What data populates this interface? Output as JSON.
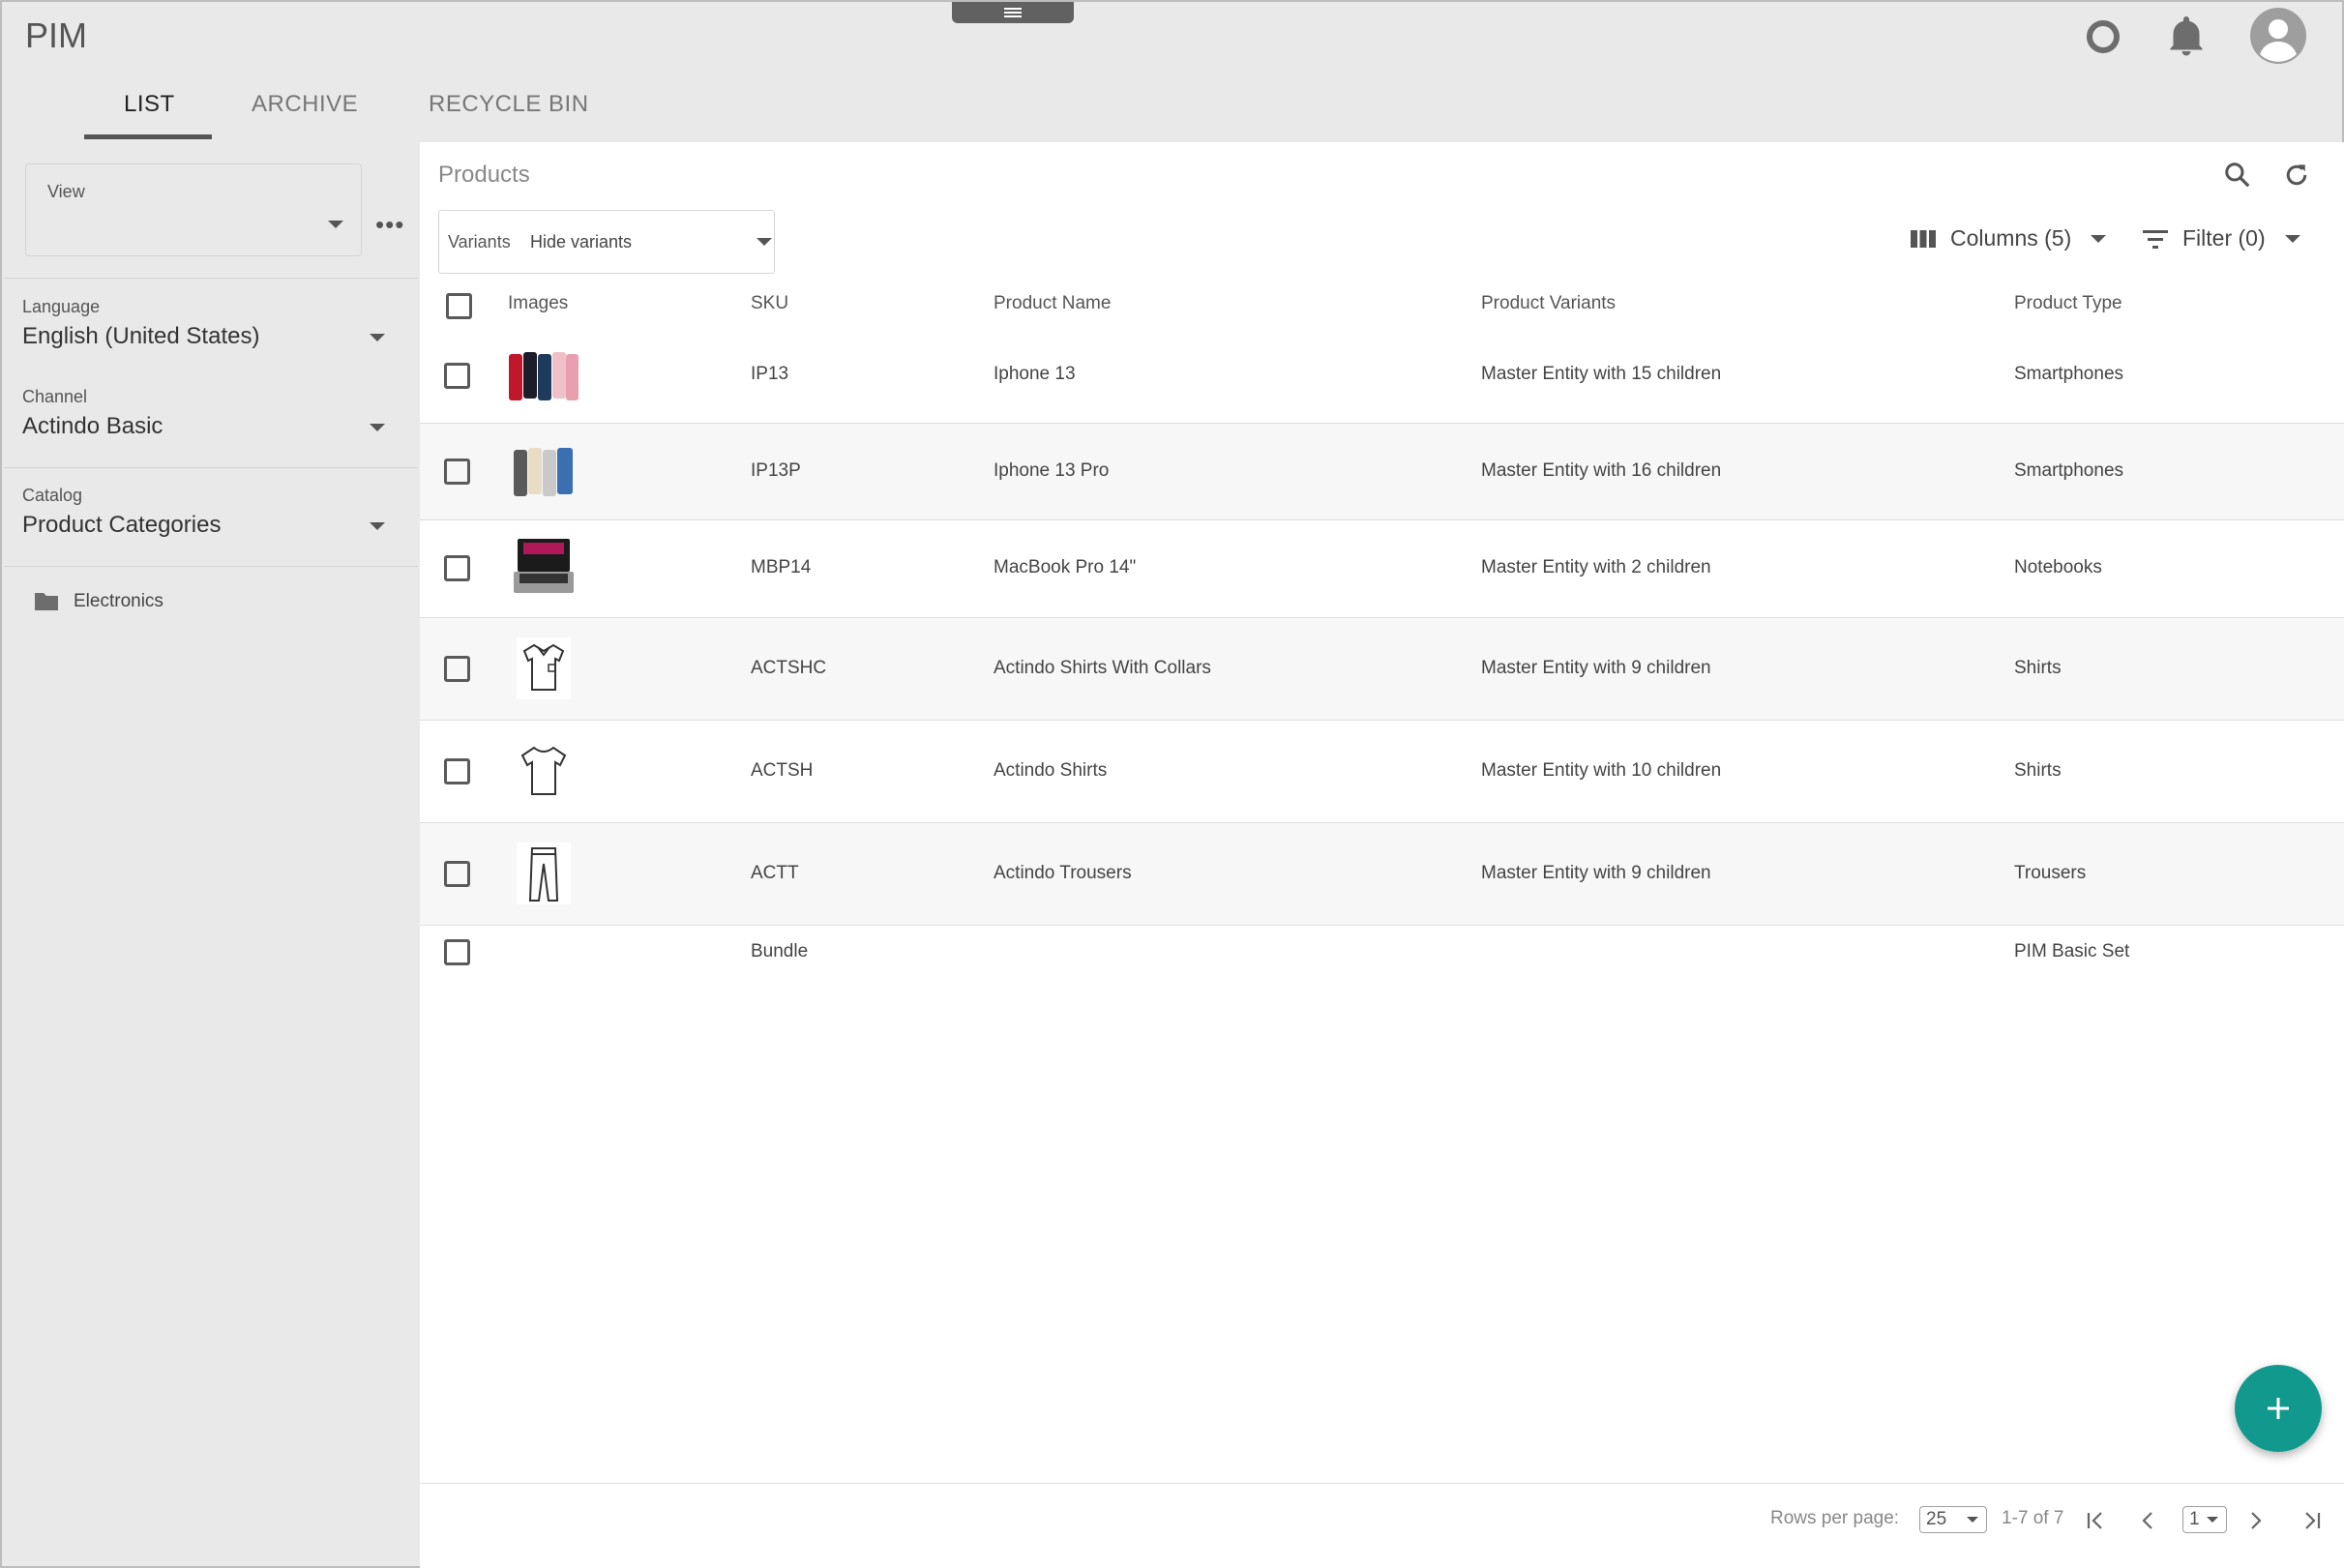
{
  "app": {
    "title": "PIM"
  },
  "tabs": [
    {
      "label": "LIST",
      "active": true
    },
    {
      "label": "ARCHIVE",
      "active": false
    },
    {
      "label": "RECYCLE BIN",
      "active": false
    }
  ],
  "sidebar": {
    "view_label": "View",
    "view_value": "",
    "language_label": "Language",
    "language_value": "English (United States)",
    "channel_label": "Channel",
    "channel_value": "Actindo Basic",
    "catalog_label": "Catalog",
    "catalog_value": "Product Categories",
    "tree": [
      {
        "label": "Electronics",
        "icon": "folder-icon"
      }
    ]
  },
  "main": {
    "title": "Products",
    "variants_label": "Variants",
    "variants_value": "Hide variants",
    "columns_label": "Columns (5)",
    "filter_label": "Filter (0)"
  },
  "table": {
    "headers": [
      "Images",
      "SKU",
      "Product Name",
      "Product Variants",
      "Product Type"
    ],
    "rows": [
      {
        "image": "iphone-13-image",
        "sku": "IP13",
        "name": "Iphone 13",
        "variants": "Master Entity with 15 children",
        "type": "Smartphones"
      },
      {
        "image": "iphone-13-pro-image",
        "sku": "IP13P",
        "name": "Iphone 13 Pro",
        "variants": "Master Entity with 16 children",
        "type": "Smartphones"
      },
      {
        "image": "macbook-image",
        "sku": "MBP14",
        "name": "MacBook Pro 14\"",
        "variants": "Master Entity with 2 children",
        "type": "Notebooks"
      },
      {
        "image": "collar-shirt-image",
        "sku": "ACTSHC",
        "name": "Actindo Shirts With Collars",
        "variants": "Master Entity with 9 children",
        "type": "Shirts"
      },
      {
        "image": "tshirt-image",
        "sku": "ACTSH",
        "name": "Actindo Shirts",
        "variants": "Master Entity with 10 children",
        "type": "Shirts"
      },
      {
        "image": "trousers-image",
        "sku": "ACTT",
        "name": "Actindo Trousers",
        "variants": "Master Entity with 9 children",
        "type": "Trousers"
      },
      {
        "image": "",
        "sku": "Bundle",
        "name": "",
        "variants": "",
        "type": "PIM Basic Set"
      }
    ]
  },
  "pagination": {
    "rows_per_page_label": "Rows per page:",
    "rows_per_page": "25",
    "range": "1-7 of 7",
    "page": "1"
  },
  "colors": {
    "accent": "#11998e",
    "tab_underline": "#555555",
    "background": "#e9e9e9"
  }
}
